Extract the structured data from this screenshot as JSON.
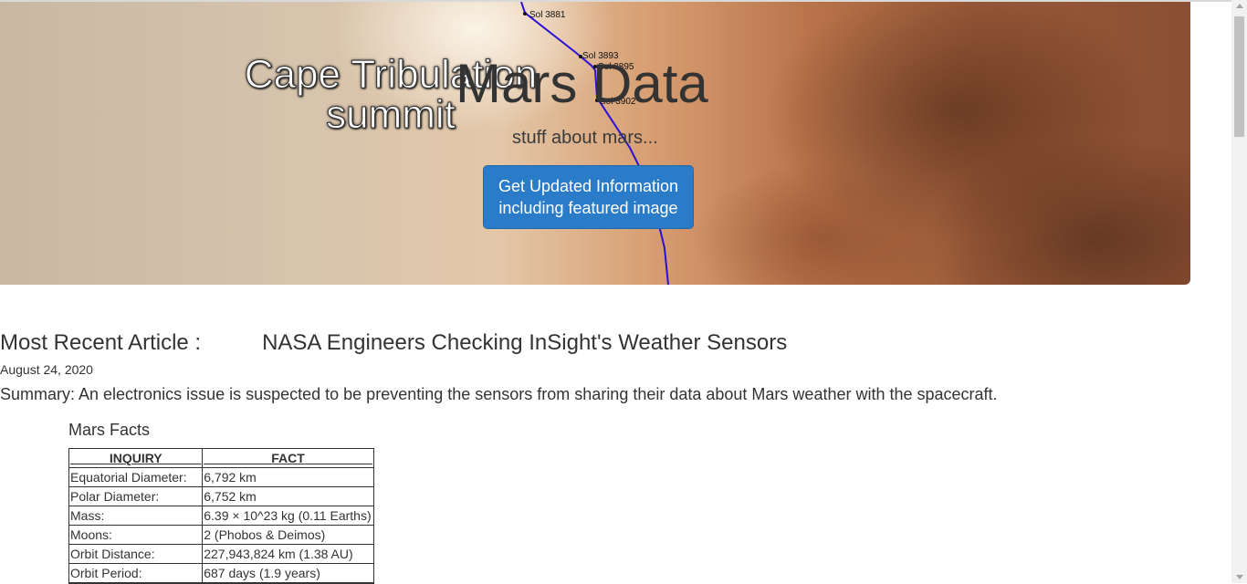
{
  "hero": {
    "image_title_line1": "Cape Tribulation",
    "image_title_line2": "summit",
    "sol_labels": [
      "Sol 3881",
      "Sol 3893",
      "Sol 3895",
      "Sol 3902"
    ],
    "title": "Mars Data",
    "subtitle": "stuff about mars...",
    "button_line1": "Get Updated Information",
    "button_line2": "including featured image",
    "button_color": "#2a7bc8"
  },
  "article": {
    "label": "Most Recent Article :",
    "title": "NASA Engineers Checking InSight's Weather Sensors",
    "date": "August 24, 2020",
    "summary": "Summary: An electronics issue is suspected to be preventing the sensors from sharing their data about Mars weather with the spacecraft."
  },
  "facts": {
    "heading": "Mars Facts",
    "columns": [
      "INQUIRY",
      "FACT"
    ],
    "rows": [
      [
        "Equatorial Diameter:",
        "6,792 km"
      ],
      [
        "Polar Diameter:",
        "6,752 km"
      ],
      [
        "Mass:",
        "6.39 × 10^23 kg (0.11 Earths)"
      ],
      [
        "Moons:",
        "2 (Phobos & Deimos)"
      ],
      [
        "Orbit Distance:",
        "227,943,824 km (1.38 AU)"
      ],
      [
        "Orbit Period:",
        "687 days (1.9 years)"
      ]
    ]
  }
}
